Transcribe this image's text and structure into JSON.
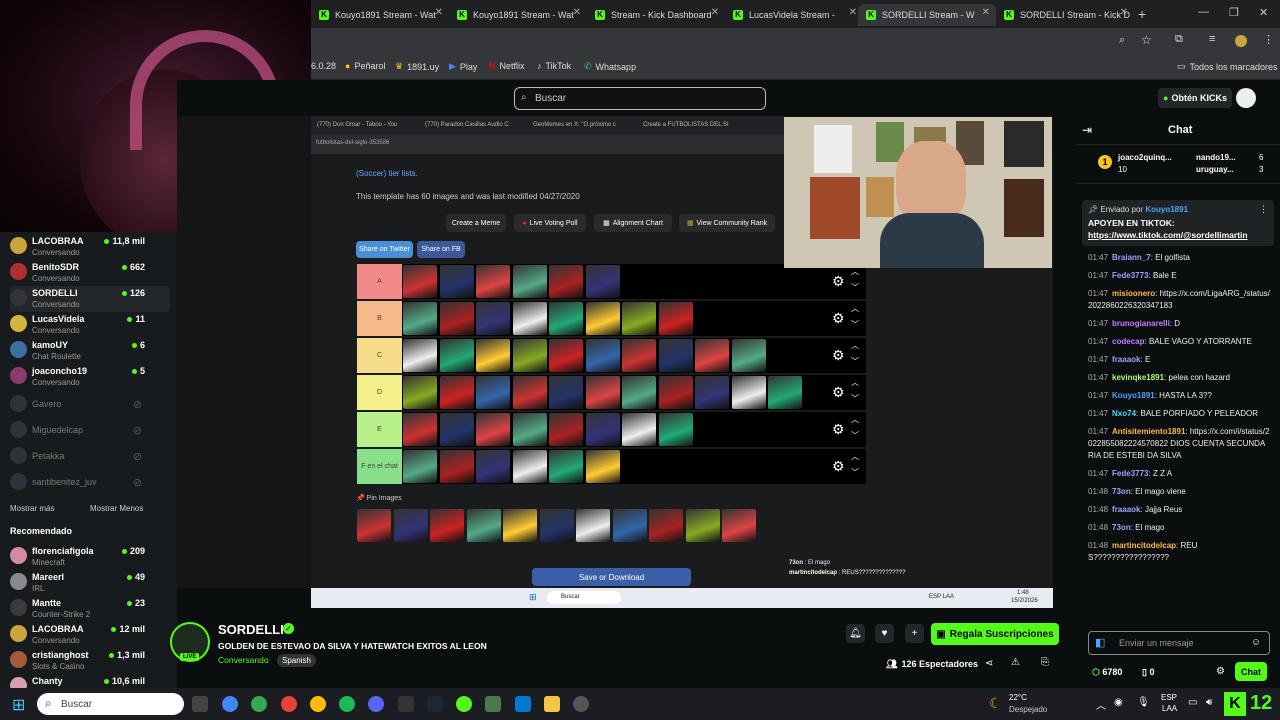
{
  "browser": {
    "tabs": [
      {
        "label": "Kouyo1891 Stream - Wat",
        "active": false
      },
      {
        "label": "Kouyo1891 Stream - Wat",
        "active": false
      },
      {
        "label": "Stream - Kick Dashboard",
        "active": false
      },
      {
        "label": "LucasVidela Stream -",
        "active": false
      },
      {
        "label": "SORDELLI Stream - W",
        "active": true
      },
      {
        "label": "SORDELLI Stream - Kick D",
        "active": false
      }
    ],
    "new_tab": "+",
    "bookmarks": [
      "6.0.28",
      "Peñarol",
      "1891.uy",
      "Play",
      "Netflix",
      "TikTok",
      "Whatsapp"
    ],
    "all_bookmarks": "Todos los marcadores"
  },
  "kick": {
    "search_placeholder": "Buscar",
    "get_kicks": "Obtén KICKs"
  },
  "sidebar": {
    "following": [
      {
        "name": "LACOBRAA",
        "sub": "Conversando",
        "count": "11,8 mil",
        "live": true
      },
      {
        "name": "BenitoSDR",
        "sub": "Conversando",
        "count": "662",
        "live": true
      },
      {
        "name": "SORDELLI",
        "sub": "Conversando",
        "count": "126",
        "live": true
      },
      {
        "name": "LucasVidela",
        "sub": "Conversando",
        "count": "11",
        "live": true
      },
      {
        "name": "kamoUY",
        "sub": "Chat Roulette",
        "count": "6",
        "live": true
      },
      {
        "name": "joaconcho19",
        "sub": "Conversando",
        "count": "5",
        "live": true
      },
      {
        "name": "Gavero",
        "sub": "",
        "count": "",
        "live": false
      },
      {
        "name": "Miguedelcap",
        "sub": "",
        "count": "",
        "live": false
      },
      {
        "name": "Petakka",
        "sub": "",
        "count": "",
        "live": false
      },
      {
        "name": "santibenitez_juv",
        "sub": "",
        "count": "",
        "live": false
      }
    ],
    "show_more": "Mostrar más",
    "show_less": "Mostrar Menos",
    "recommended_title": "Recomendado",
    "recommended": [
      {
        "name": "florenciafigola",
        "sub": "Minecraft",
        "count": "209"
      },
      {
        "name": "Mareerl",
        "sub": "IRL",
        "count": "49"
      },
      {
        "name": "Mantte",
        "sub": "Counter-Strike 2",
        "count": "23"
      },
      {
        "name": "LACOBRAA",
        "sub": "Conversando",
        "count": "12 mil"
      },
      {
        "name": "cristianghost",
        "sub": "Slots & Casino",
        "count": "1,3 mil"
      },
      {
        "name": "Chanty",
        "sub": "",
        "count": "10,6 mil"
      }
    ]
  },
  "video": {
    "inner_tabs": [
      "(770) Don Omar - Taboo - You",
      "(770) Paradon Casillas Audio C",
      "GeoMemes en X: \"O próximo c",
      "Create a FUTBOLISTAS DEL SI"
    ],
    "inner_url": "futbolistas-del-siglo-353586",
    "tier_link": "(Soccer) tier lists.",
    "template_note": "This template has 60 images and was last modified 04/27/2020",
    "buttons": [
      "Create a Meme",
      "Live Voting Poll",
      "Alignment Chart",
      "View Community Rank"
    ],
    "share": [
      "Share on Twitter",
      "Share on FB"
    ],
    "tiers": [
      {
        "label": "A",
        "color": "#f28a8a",
        "count": 6
      },
      {
        "label": "B",
        "color": "#f6b98a",
        "count": 8
      },
      {
        "label": "C",
        "color": "#f6dc8a",
        "count": 10
      },
      {
        "label": "D",
        "color": "#f4f08a",
        "count": 11
      },
      {
        "label": "E",
        "color": "#b8f08a",
        "count": 8
      },
      {
        "label": "F en el chat",
        "color": "#8ae08a",
        "count": 6
      }
    ],
    "pin_images": "Pin Images",
    "download_button": "Save or Download",
    "overlay_chat": [
      {
        "user": "73on",
        "text": "El mago"
      },
      {
        "user": "martincitodelcap",
        "text": "REUS??????????????"
      }
    ],
    "inner_taskbar": {
      "search": "Buscar",
      "time": "1:48",
      "date": "15/2/2026",
      "lang": "ESP LAA"
    }
  },
  "streamer": {
    "name": "SORDELLI",
    "live_badge": "LIVE",
    "title": "GOLDEN DE ESTEVAO DA SILVA Y HATEWATCH EXITOS AL LEON",
    "category": "Conversando",
    "language": "Spanish",
    "subscribe_button": "Regala Suscripciones",
    "viewers": "126 Espectadores"
  },
  "chat": {
    "title": "Chat",
    "top_gifters": [
      {
        "name": "joaco2quinq...",
        "amount": "10"
      },
      {
        "name": "nando19...",
        "amount": "6"
      },
      {
        "name": "uruguay...",
        "amount": "3"
      }
    ],
    "pinned_by": "Enviado por",
    "pinned_user": "Kouyo1891",
    "pinned_text": "APOYEN EN TIKTOK:",
    "pinned_link": "https://www.tiktok.com/@sordellimartin",
    "messages": [
      {
        "time": "01:47",
        "user": "Braiann_7",
        "text": "El golfista",
        "color": "#9aa4ff"
      },
      {
        "time": "01:47",
        "user": "Fede3773",
        "text": "Bale E",
        "color": "#9aa4ff"
      },
      {
        "time": "01:47",
        "user": "misioonero",
        "text": "https://x.com/LigaARG_/status/2022860226320347183",
        "color": "#ffb84d"
      },
      {
        "time": "01:47",
        "user": "brunogianarelli",
        "text": "D",
        "color": "#c77dff"
      },
      {
        "time": "01:47",
        "user": "codecap",
        "text": "BALE VAGO Y ATORRANTE",
        "color": "#c77dff"
      },
      {
        "time": "01:47",
        "user": "fraaaok",
        "text": "E",
        "color": "#9aa4ff"
      },
      {
        "time": "01:47",
        "user": "kevinqke1891",
        "text": "pelea con hazard",
        "color": "#a6ff6e"
      },
      {
        "time": "01:47",
        "user": "Kouyo1891",
        "text": "HASTA LA 3??",
        "color": "#4da3ff"
      },
      {
        "time": "01:47",
        "user": "Nxo74",
        "text": "BALE PORFIADO Y PELEADOR",
        "color": "#4dd6ff"
      },
      {
        "time": "01:47",
        "user": "Antisitemiento1891",
        "text": "https://x.com/i/status/2022855082224570822 DIOS CUENTA SECUNDARIA DE ESTEBI DA SILVA",
        "color": "#ffb84d"
      },
      {
        "time": "01:47",
        "user": "Fede3773",
        "text": "Z Z A",
        "color": "#9aa4ff"
      },
      {
        "time": "01:48",
        "user": "73on",
        "text": "El mago viene",
        "color": "#9aa4ff"
      },
      {
        "time": "01:48",
        "user": "fraaaok",
        "text": "Jajja Reus",
        "color": "#9aa4ff"
      },
      {
        "time": "01:48",
        "user": "73on",
        "text": "El mago",
        "color": "#9aa4ff"
      },
      {
        "time": "01:48",
        "user": "martincitodelcap",
        "text": "REUS?????????????????",
        "color": "#ffb84d"
      }
    ],
    "input_placeholder": "Enviar un mensaje",
    "kicks_balance": "6780",
    "points": "0",
    "chat_button": "Chat"
  },
  "taskbar": {
    "search_placeholder": "Buscar",
    "weather_temp": "22°C",
    "weather_desc": "Despejado",
    "lang": "ESP",
    "region": "LAA",
    "notification_count": "12"
  }
}
